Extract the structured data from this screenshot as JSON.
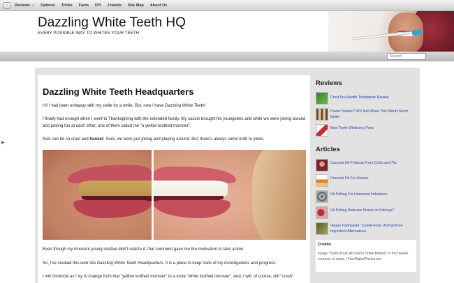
{
  "nav": {
    "items": [
      {
        "label": "Reviews",
        "has_dropdown": true
      },
      {
        "label": "Options"
      },
      {
        "label": "Tricks"
      },
      {
        "label": "Facts"
      },
      {
        "label": "DIY"
      },
      {
        "label": "Friends"
      },
      {
        "label": "Site Map"
      },
      {
        "label": "About Us"
      }
    ]
  },
  "header": {
    "title": "Dazzling White Teeth HQ",
    "tagline": "EVERY POSSIBLE WAY TO WHITEN YOUR TEETH"
  },
  "search": {
    "placeholder": "Search"
  },
  "main": {
    "heading": "Dazzling White Teeth Headquarters",
    "p1_a": "Hi!  I had been unhappy with my smile for a while.  But, now I have ",
    "p1_em": "Dazzling White Teeth!",
    "p2": "I finally had enough when I went to Thanksgiving with the extended family.  My cousin brought his youngsters and while we were joking around and poking fun at each other, one of them called me \"a yellow toothed monster\".",
    "p3_a": "Kids can be so cruel and ",
    "p3_strong": "honest",
    "p3_b": ".  Sure, we were just joking and playing around.  But, there's always some truth to jokes.",
    "p4": "Even though my innocent young relative didn't realize it, that comment gave me the motivation to take action.",
    "p5_a": "So, I've created this web site ",
    "p5_em": "Dazzling White Teeth Headquarters.",
    "p5_b": "  It is a place to keep track of my investigations and progress.",
    "p6": "I will chronicle as I try to change from that \"yellow toothed monster\" to a more \"white toothed monster\".  And, I will, of course, still \"crush\""
  },
  "sidebar": {
    "reviews_heading": "Reviews",
    "reviews": [
      {
        "label": "Crest Pro Health Toothpaste Review",
        "icon": "toothpaste-thumb"
      },
      {
        "label": "Power Swabs? NO! Not When This Works Much Better",
        "icon": "swabs-thumb"
      },
      {
        "label": "Best Teeth Whitening Pens",
        "icon": "pen-thumb"
      }
    ],
    "articles_heading": "Articles",
    "articles": [
      {
        "label": "Coconut Oil Protects From Colds and Flu",
        "icon": "woman-thumb"
      },
      {
        "label": "Coconut Oil For Herpes",
        "icon": "jar-thumb"
      },
      {
        "label": "Oil Pulling For Hormonal Imbalance",
        "icon": "shell-thumb"
      },
      {
        "label": "Oil Pulling Reduces Stress on Kidneys?",
        "icon": "kidney-thumb"
      },
      {
        "label": "Vegan Toothpaste: Cruelty-Free, Animal Free Ingredient Alternatives",
        "icon": "tooth-thumb"
      }
    ],
    "credits_heading": "Credits",
    "credits_text": "Image \"Teeth Brush And Girl's Smile Behind\" in the header courtesy of marin / FreeDigitalPhotos.net"
  }
}
